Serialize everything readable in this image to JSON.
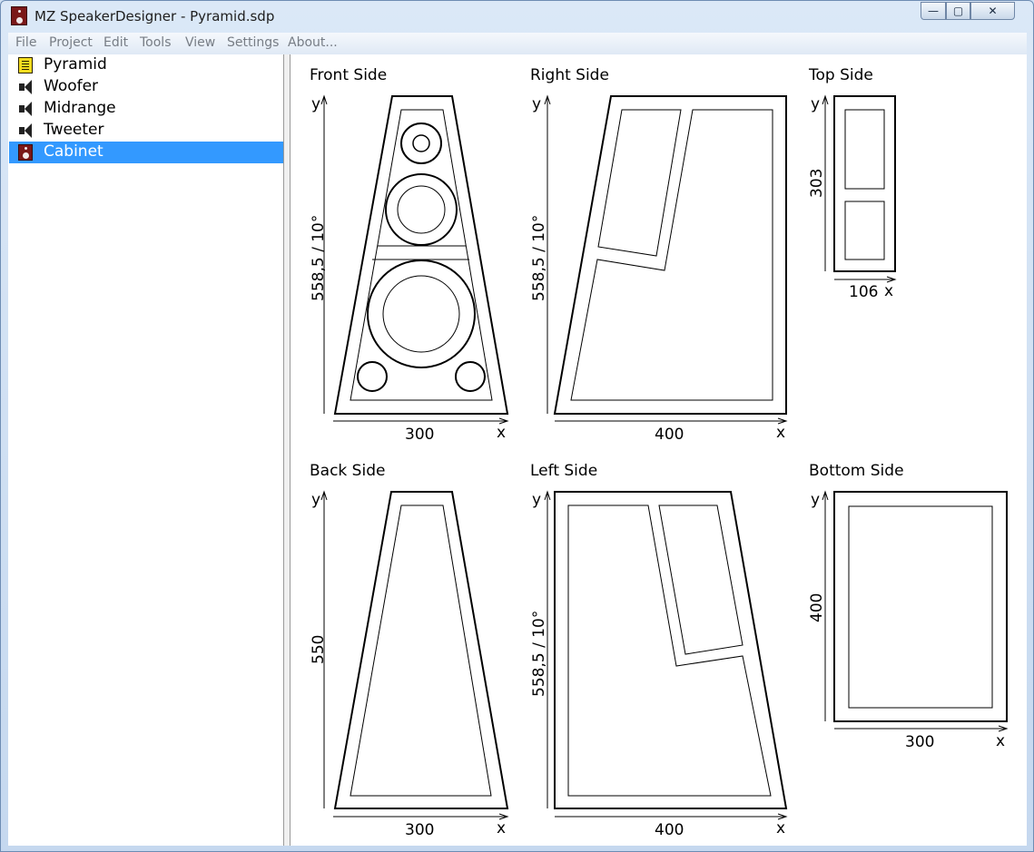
{
  "window": {
    "title": "MZ SpeakerDesigner - Pyramid.sdp",
    "buttons": {
      "minimize": "—",
      "maximize": "▢",
      "close": "✕"
    }
  },
  "menu": [
    "File",
    "Project",
    "Edit",
    "Tools",
    "View",
    "Settings",
    "About..."
  ],
  "tree": {
    "items": [
      {
        "label": "Pyramid",
        "icon": "project-icon"
      },
      {
        "label": "Woofer",
        "icon": "speaker-icon"
      },
      {
        "label": "Midrange",
        "icon": "speaker-icon"
      },
      {
        "label": "Tweeter",
        "icon": "speaker-icon"
      },
      {
        "label": "Cabinet",
        "icon": "cabinet-icon",
        "selected": true
      }
    ]
  },
  "views": {
    "front": {
      "title": "Front Side",
      "width": "300",
      "height": "558,5 / 10°",
      "x_axis": "x",
      "y_axis": "y"
    },
    "right": {
      "title": "Right Side",
      "width": "400",
      "height": "558,5 / 10°",
      "x_axis": "x",
      "y_axis": "y"
    },
    "top": {
      "title": "Top Side",
      "width": "106",
      "height": "303",
      "x_axis": "x",
      "y_axis": "y"
    },
    "back": {
      "title": "Back Side",
      "width": "300",
      "height": "550",
      "x_axis": "x",
      "y_axis": "y"
    },
    "left": {
      "title": "Left Side",
      "width": "400",
      "height": "558,5 / 10°",
      "x_axis": "x",
      "y_axis": "y"
    },
    "bottom": {
      "title": "Bottom Side",
      "width": "300",
      "height": "400",
      "x_axis": "x",
      "y_axis": "y"
    }
  },
  "colors": {
    "selection": "#3399ff",
    "frame": "#c5d8ef",
    "cabinet_icon": "#7a1818",
    "project_icon": "#f6dd1f"
  }
}
